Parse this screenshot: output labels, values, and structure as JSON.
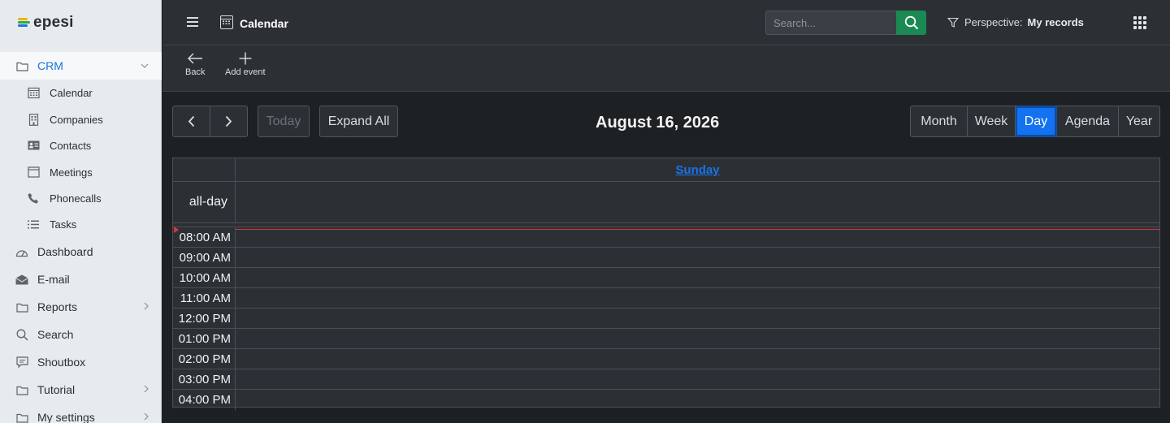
{
  "brand": {
    "name": "epesi",
    "colors": [
      "#f0b400",
      "#2fa84f",
      "#1a73d9"
    ]
  },
  "sidebar": {
    "crm": {
      "label": "CRM",
      "icon": "folder-icon"
    },
    "crm_children": [
      {
        "label": "Calendar",
        "icon": "calendar-icon"
      },
      {
        "label": "Companies",
        "icon": "building-icon"
      },
      {
        "label": "Contacts",
        "icon": "id-card-icon"
      },
      {
        "label": "Meetings",
        "icon": "window-icon"
      },
      {
        "label": "Phonecalls",
        "icon": "phone-icon"
      },
      {
        "label": "Tasks",
        "icon": "list-icon"
      }
    ],
    "items": [
      {
        "label": "Dashboard",
        "icon": "gauge-icon"
      },
      {
        "label": "E-mail",
        "icon": "envelope-icon"
      },
      {
        "label": "Reports",
        "icon": "folder-icon"
      },
      {
        "label": "Search",
        "icon": "search-icon"
      },
      {
        "label": "Shoutbox",
        "icon": "chat-icon"
      },
      {
        "label": "Tutorial",
        "icon": "folder-icon"
      },
      {
        "label": "My settings",
        "icon": "folder-icon"
      }
    ]
  },
  "header": {
    "title": "Calendar",
    "search_placeholder": "Search...",
    "perspective_label": "Perspective:",
    "perspective_value": "My records"
  },
  "actions": {
    "back": "Back",
    "add_event": "Add event"
  },
  "calendar": {
    "today": "Today",
    "expand_all": "Expand All",
    "date_title": "August 16, 2026",
    "views": [
      "Month",
      "Week",
      "Day",
      "Agenda",
      "Year"
    ],
    "active_view": "Day",
    "day_name": "Sunday",
    "allday_label": "all-day",
    "time_slots": [
      "08:00 AM",
      "09:00 AM",
      "10:00 AM",
      "11:00 AM",
      "12:00 PM",
      "01:00 PM",
      "02:00 PM",
      "03:00 PM",
      "04:00 PM"
    ],
    "now_indicator_color": "#d33a3a",
    "accent": "#1372f0"
  }
}
